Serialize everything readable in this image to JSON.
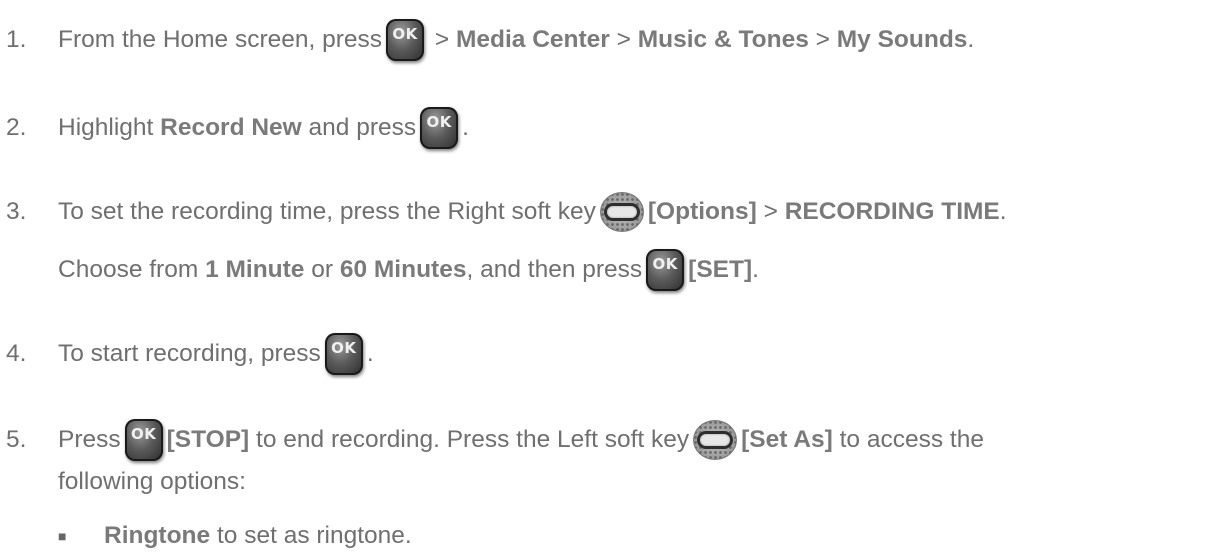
{
  "steps": [
    {
      "num": "1.",
      "parts": {
        "t0": "From the Home screen, press",
        "t1": " > ",
        "b1": "Media Center",
        "t2": " > ",
        "b2": "Music & Tones",
        "t3": " > ",
        "b3": "My Sounds",
        "t4": "."
      }
    },
    {
      "num": "2.",
      "parts": {
        "t0": "Highlight ",
        "b1": "Record New",
        "t1": " and press",
        "t2": "."
      }
    },
    {
      "num": "3.",
      "parts": {
        "t0": "To set the recording time, press the Right soft key",
        "b1": "[Options]",
        "t1": " > ",
        "b2": "RECORDING TIME",
        "t2": ".",
        "l2_t0": "Choose from ",
        "l2_b1": "1 Minute",
        "l2_t1": " or ",
        "l2_b2": "60 Minutes",
        "l2_t2": ", and then press",
        "l2_b3": "[SET]",
        "l2_t3": "."
      }
    },
    {
      "num": "4.",
      "parts": {
        "t0": "To start recording, press",
        "t1": "."
      }
    },
    {
      "num": "5.",
      "parts": {
        "t0": "Press",
        "b1": "[STOP]",
        "t1": " to end recording. Press the Left soft key",
        "b2": "[Set As]",
        "t2": " to access the",
        "l2_t0": "following options:"
      }
    }
  ],
  "sub_items": [
    {
      "b": "Ringtone",
      "t": " to set as ringtone."
    }
  ],
  "keys": {
    "ok_label": "OK",
    "ok_icon": "ok-key-icon",
    "soft_icon": "soft-key-icon"
  }
}
